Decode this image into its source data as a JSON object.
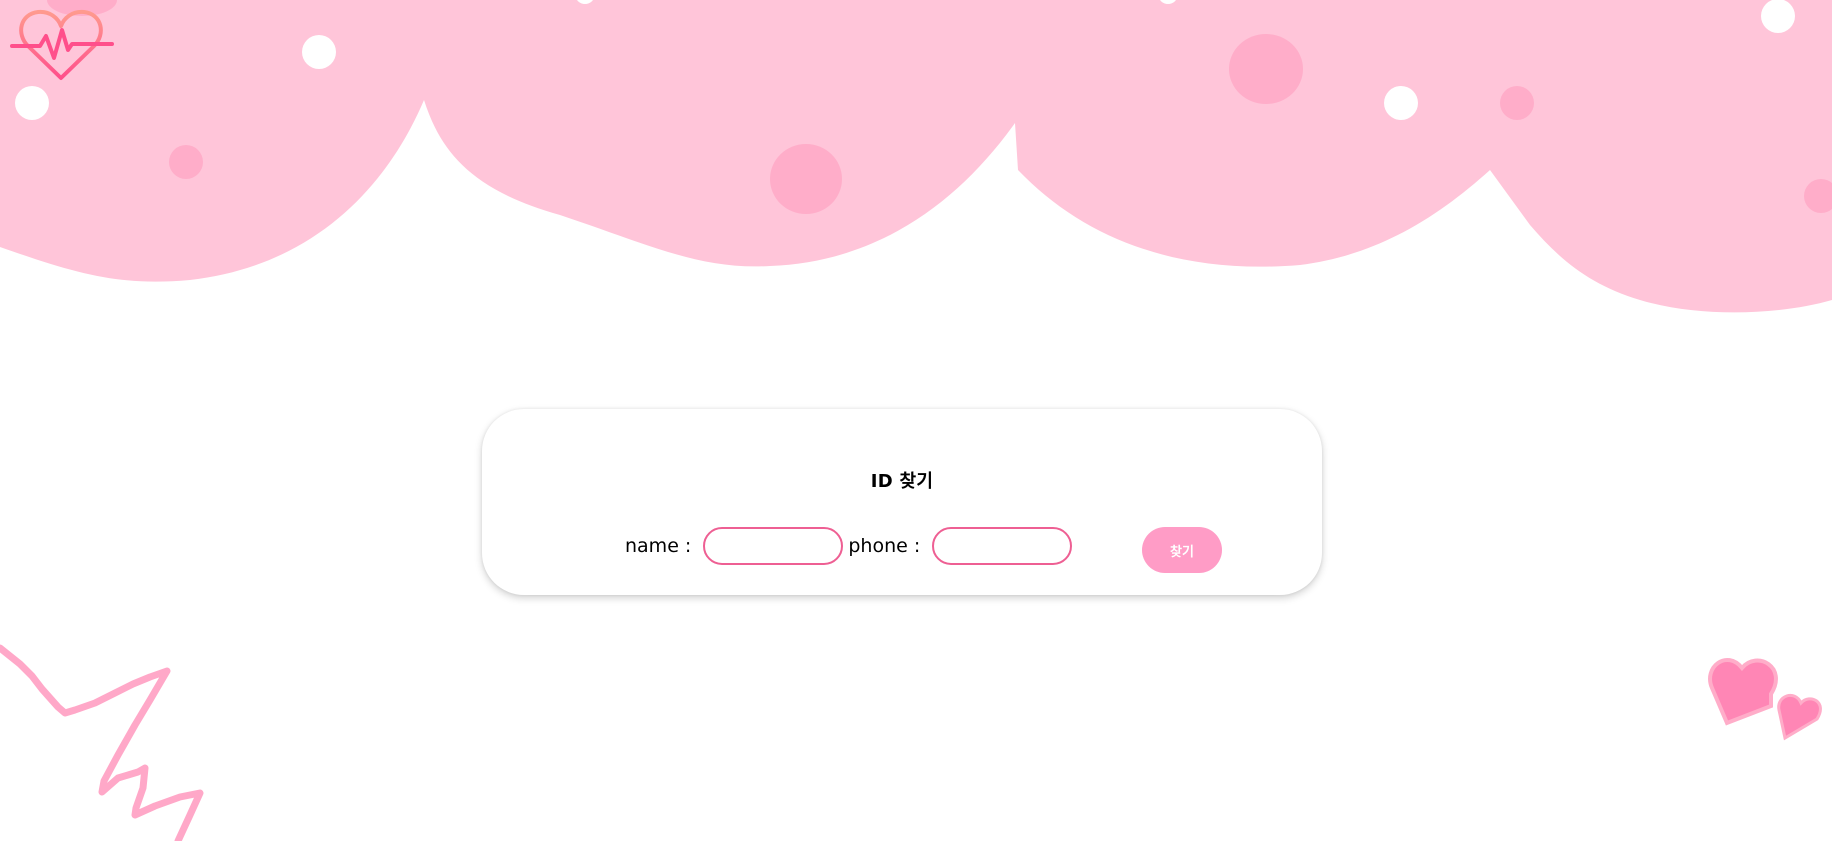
{
  "header": {
    "logo_icon": "heart-pulse-icon"
  },
  "find_id_form": {
    "title": "ID 찾기",
    "name_label": "name : ",
    "name_value": "",
    "phone_label": "phone : ",
    "phone_value": "",
    "submit_label": "찾기"
  },
  "theme": {
    "cloud_pink": "#ffc5d9",
    "dot_pink": "#ffadc9",
    "accent_pink": "#ee5f93",
    "button_pink": "#ff9cc6",
    "heart_pink": "#ff86b5"
  },
  "decorations": {
    "top": "pink-cloud-banner",
    "bottom_left": "zigzag-scribble",
    "bottom_right": "hearts-icon"
  }
}
